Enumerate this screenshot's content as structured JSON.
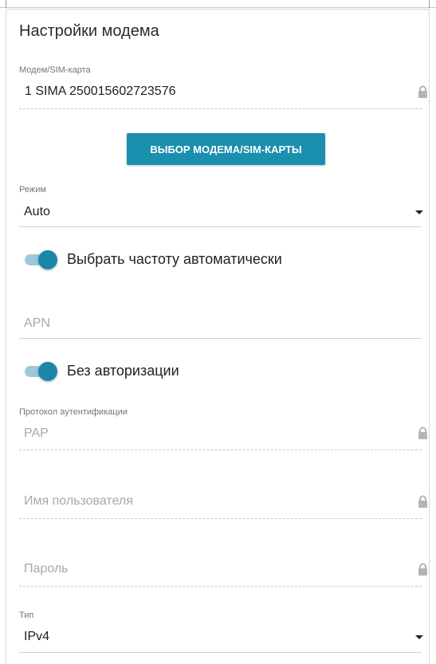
{
  "page_title": "Настройки модема",
  "modem_sim": {
    "label": "Модем/SIM-карта",
    "value": "1 SIMA 250015602723576"
  },
  "select_button": {
    "label": "ВЫБОР МОДЕМА/SIM-КАРТЫ"
  },
  "mode": {
    "label": "Режим",
    "value": "Auto"
  },
  "auto_frequency": {
    "label": "Выбрать частоту автоматически",
    "enabled": true
  },
  "apn": {
    "placeholder": "APN"
  },
  "no_auth": {
    "label": "Без авторизации",
    "enabled": true
  },
  "auth_protocol": {
    "label": "Протокол аутентификации",
    "value": "PAP"
  },
  "username": {
    "placeholder": "Имя пользователя"
  },
  "password": {
    "placeholder": "Пароль"
  },
  "type": {
    "label": "Тип",
    "value": "IPv4"
  },
  "colors": {
    "accent": "#1b8fae",
    "toggle_track": "#9cc9d9",
    "toggle_knob": "#1b86a8"
  },
  "icons": {
    "lock": "lock-icon",
    "dropdown": "chevron-down-icon"
  }
}
